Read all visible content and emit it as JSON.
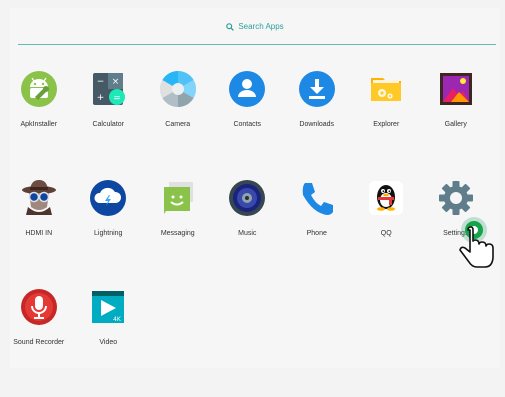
{
  "search": {
    "label": "Search Apps"
  },
  "apps": [
    {
      "label": "ApkInstaller",
      "icon": "android-installer-icon"
    },
    {
      "label": "Calculator",
      "icon": "calculator-icon"
    },
    {
      "label": "Camera",
      "icon": "camera-icon"
    },
    {
      "label": "Contacts",
      "icon": "contacts-icon"
    },
    {
      "label": "Downloads",
      "icon": "downloads-icon"
    },
    {
      "label": "Explorer",
      "icon": "folder-explorer-icon"
    },
    {
      "label": "Gallery",
      "icon": "gallery-icon"
    },
    {
      "label": "HDMI IN",
      "icon": "hdmi-in-detective-icon"
    },
    {
      "label": "Lightning",
      "icon": "lightning-cloud-icon"
    },
    {
      "label": "Messaging",
      "icon": "messaging-icon"
    },
    {
      "label": "Music",
      "icon": "music-speaker-icon"
    },
    {
      "label": "Phone",
      "icon": "phone-icon"
    },
    {
      "label": "QQ",
      "icon": "qq-penguin-icon"
    },
    {
      "label": "Settings",
      "icon": "gear-icon"
    },
    {
      "label": "Sound Recorder",
      "icon": "microphone-icon"
    },
    {
      "label": "Video",
      "icon": "video-4k-icon"
    }
  ],
  "colors": {
    "accent": "#2e9f99",
    "background": "#f6f6f6"
  }
}
